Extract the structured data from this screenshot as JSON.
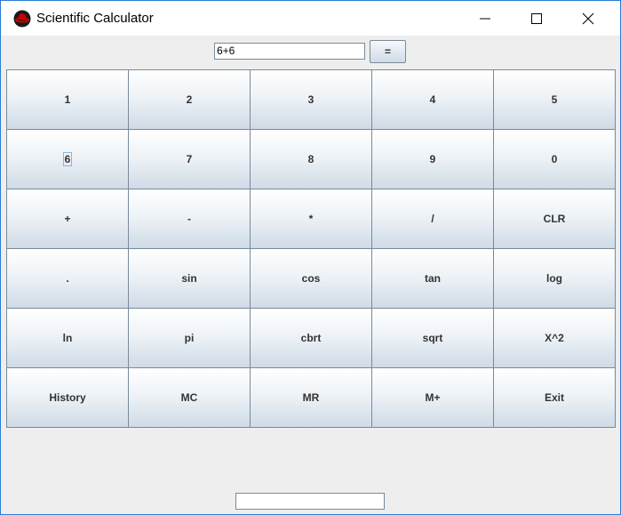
{
  "window": {
    "title": "Scientific Calculator",
    "icon": "redhat-logo-icon",
    "controls": [
      "minimize-icon",
      "maximize-icon",
      "close-icon"
    ],
    "accent_color": "#2b7cd3"
  },
  "input": {
    "expression": "6+6",
    "equals_label": "="
  },
  "keys": [
    "1",
    "2",
    "3",
    "4",
    "5",
    "6",
    "7",
    "8",
    "9",
    "0",
    "+",
    "-",
    "*",
    "/",
    "CLR",
    ".",
    "sin",
    "cos",
    "tan",
    "log",
    "ln",
    "pi",
    "cbrt",
    "sqrt",
    "X^2",
    "History",
    "MC",
    "MR",
    "M+",
    "Exit"
  ],
  "focused_key": "6",
  "result": {
    "value": ""
  }
}
